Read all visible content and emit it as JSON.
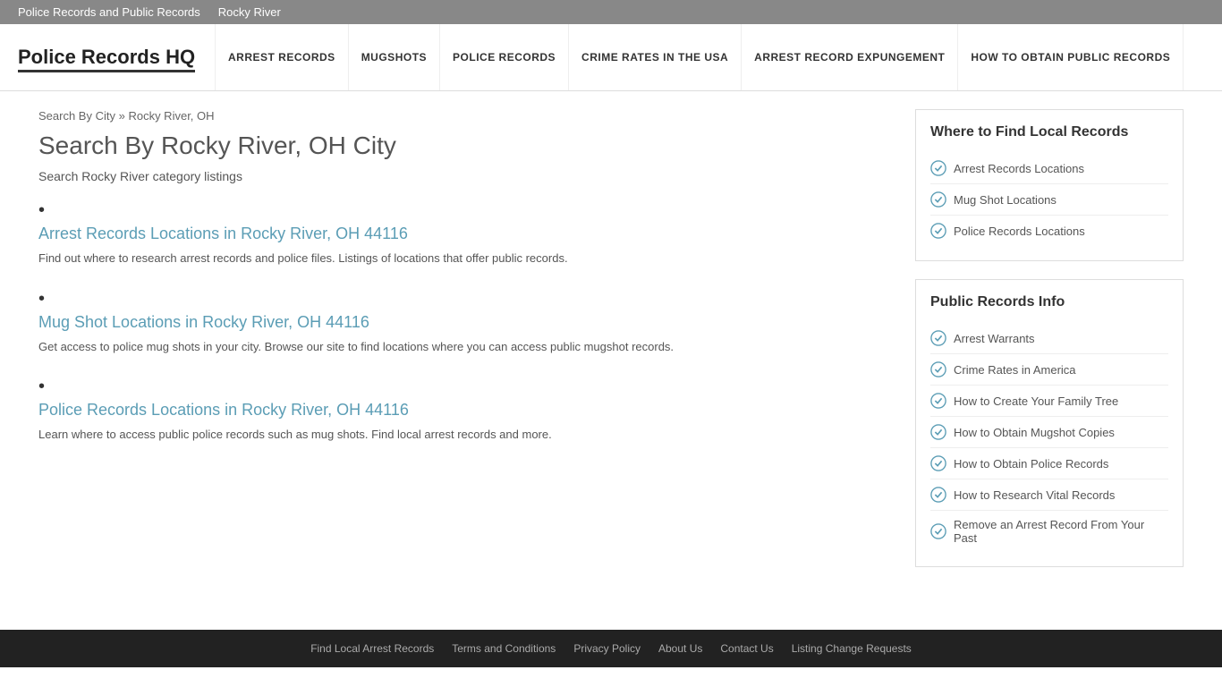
{
  "topbar": {
    "links": [
      {
        "label": "Police Records and Public Records",
        "href": "#"
      },
      {
        "label": "Rocky River",
        "href": "#"
      }
    ]
  },
  "header": {
    "logo": "Police Records HQ",
    "nav": [
      {
        "label": "ARREST RECORDS",
        "href": "#"
      },
      {
        "label": "MUGSHOTS",
        "href": "#"
      },
      {
        "label": "POLICE RECORDS",
        "href": "#"
      },
      {
        "label": "CRIME RATES IN THE USA",
        "href": "#"
      },
      {
        "label": "ARREST RECORD EXPUNGEMENT",
        "href": "#"
      },
      {
        "label": "HOW TO OBTAIN PUBLIC RECORDS",
        "href": "#"
      }
    ]
  },
  "breadcrumb": {
    "parent_label": "Search By City",
    "separator": " » ",
    "current": "Rocky River, OH"
  },
  "main": {
    "title": "Search By Rocky River, OH City",
    "subtitle": "Search Rocky River category listings",
    "listings": [
      {
        "title": "Arrest Records Locations in Rocky River, OH 44116",
        "href": "#",
        "description": "Find out where to research arrest records and police files. Listings of locations that offer public records."
      },
      {
        "title": "Mug Shot Locations in Rocky River, OH 44116",
        "href": "#",
        "description": "Get access to police mug shots in your city. Browse our site to find locations where you can access public mugshot records."
      },
      {
        "title": "Police Records Locations in Rocky River, OH 44116",
        "href": "#",
        "description": "Learn where to access public police records such as mug shots. Find local arrest records and more."
      }
    ]
  },
  "sidebar": {
    "local_records": {
      "title": "Where to Find Local Records",
      "items": [
        {
          "label": "Arrest Records Locations",
          "href": "#"
        },
        {
          "label": "Mug Shot Locations",
          "href": "#"
        },
        {
          "label": "Police Records Locations",
          "href": "#"
        }
      ]
    },
    "public_records_info": {
      "title": "Public Records Info",
      "items": [
        {
          "label": "Arrest Warrants",
          "href": "#"
        },
        {
          "label": "Crime Rates in America",
          "href": "#"
        },
        {
          "label": "How to Create Your Family Tree",
          "href": "#"
        },
        {
          "label": "How to Obtain Mugshot Copies",
          "href": "#"
        },
        {
          "label": "How to Obtain Police Records",
          "href": "#"
        },
        {
          "label": "How to Research Vital Records",
          "href": "#"
        },
        {
          "label": "Remove an Arrest Record From Your Past",
          "href": "#"
        }
      ]
    }
  },
  "footer": {
    "links": [
      {
        "label": "Find Local Arrest Records",
        "href": "#"
      },
      {
        "label": "Terms and Conditions",
        "href": "#"
      },
      {
        "label": "Privacy Policy",
        "href": "#"
      },
      {
        "label": "About Us",
        "href": "#"
      },
      {
        "label": "Contact Us",
        "href": "#"
      },
      {
        "label": "Listing Change Requests",
        "href": "#"
      }
    ]
  }
}
